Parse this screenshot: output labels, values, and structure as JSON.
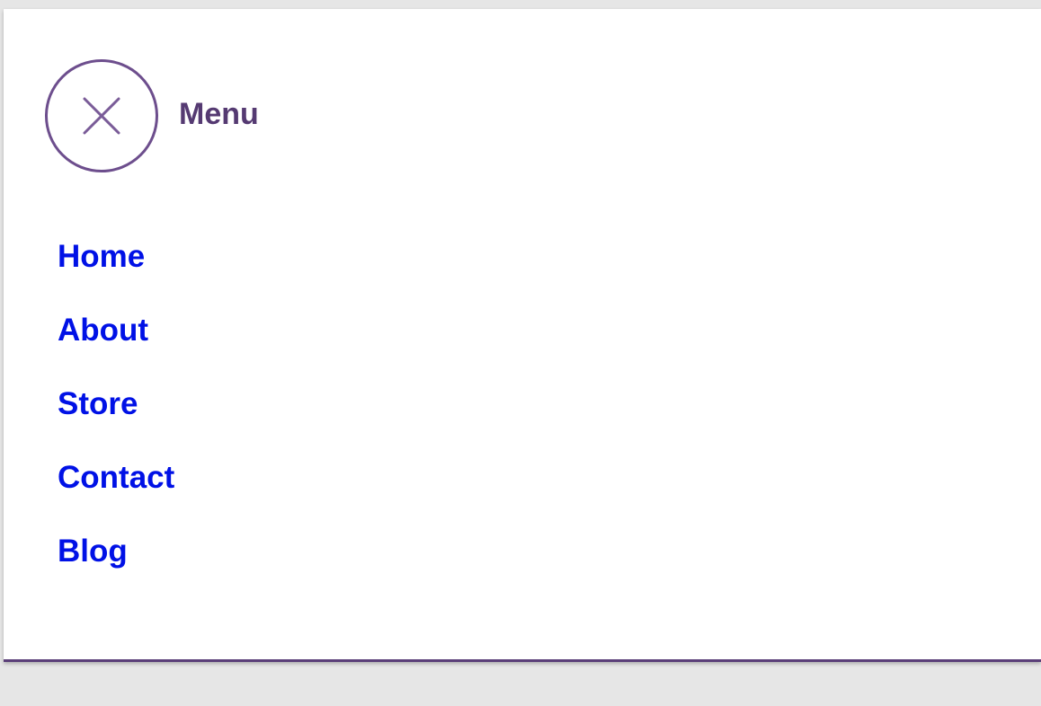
{
  "menu": {
    "title": "Menu",
    "close_icon": "close-icon",
    "accent_color": "#5a3e78",
    "link_color": "#0011e6"
  },
  "nav": {
    "items": [
      {
        "label": "Home"
      },
      {
        "label": "About"
      },
      {
        "label": "Store"
      },
      {
        "label": "Contact"
      },
      {
        "label": "Blog"
      }
    ]
  }
}
